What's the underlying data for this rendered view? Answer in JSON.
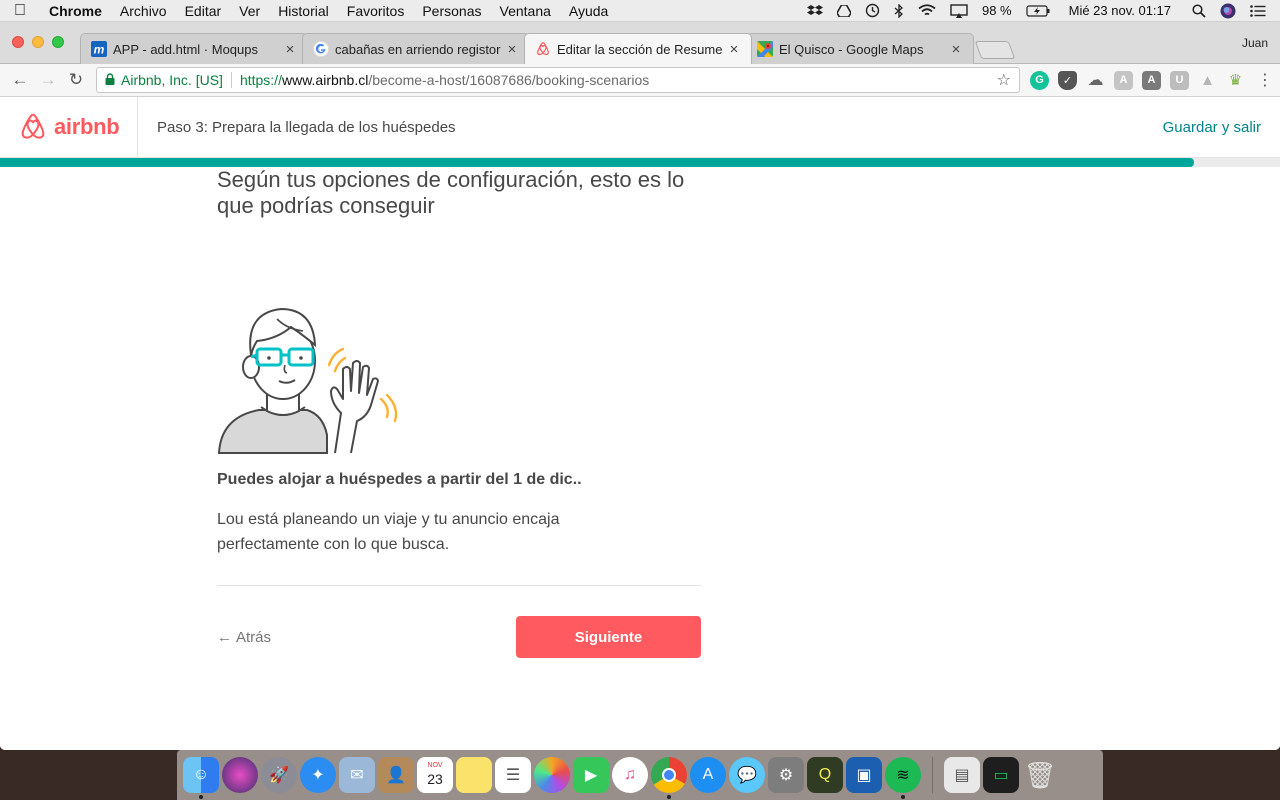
{
  "menubar": {
    "app_name": "Chrome",
    "menus": [
      "Archivo",
      "Editar",
      "Ver",
      "Historial",
      "Favoritos",
      "Personas",
      "Ventana",
      "Ayuda"
    ],
    "battery": "98 %",
    "datetime": "Mié 23 nov.  01:17"
  },
  "browser": {
    "tabs": [
      {
        "title": "APP - add.html · Moqups",
        "icon": "moqups-icon",
        "active": false
      },
      {
        "title": "cabañas en arriendo registor -",
        "icon": "google-icon",
        "active": false
      },
      {
        "title": "Editar la sección de Resumen c",
        "icon": "airbnb-icon",
        "active": true
      },
      {
        "title": "El Quisco - Google Maps",
        "icon": "maps-icon",
        "active": false
      }
    ],
    "profile_name": "Juan",
    "address": {
      "site_identity": "Airbnb, Inc. [US]",
      "scheme": "https://",
      "host": "www.airbnb.cl",
      "path": "/become-a-host/16087686/booking-scenarios"
    },
    "extensions": [
      "grammarly-icon",
      "pocket-icon",
      "cloud-icon",
      "angular-icon-1",
      "angular-icon-2",
      "u-icon",
      "drive-icon",
      "basket-icon"
    ]
  },
  "airbnb": {
    "brand": "airbnb",
    "step_title": "Paso 3: Prepara la llegada de los huéspedes",
    "save_exit": "Guardar y salir",
    "progress": 0.933,
    "headline": "Según tus opciones de configuración, esto es lo que podrías conseguir",
    "subhead": "Puedes alojar a huéspedes a partir del 1 de dic..",
    "body": "Lou está planeando un viaje y tu anuncio encaja perfectamente con lo que busca.",
    "back_label": "Atrás",
    "next_label": "Siguiente",
    "colors": {
      "brand": "#FF5A5F",
      "teal": "#00A699",
      "link": "#008489"
    }
  },
  "dock": {
    "apps": [
      "finder",
      "siri",
      "launchpad",
      "safari",
      "mail",
      "contacts",
      "calendar",
      "notes",
      "reminders",
      "photos",
      "facetime",
      "itunes",
      "chrome",
      "app-store",
      "messages",
      "system-preferences",
      "qgis",
      "sourcetree",
      "spotify"
    ],
    "calendar_month": "NOV",
    "calendar_day": "23"
  }
}
